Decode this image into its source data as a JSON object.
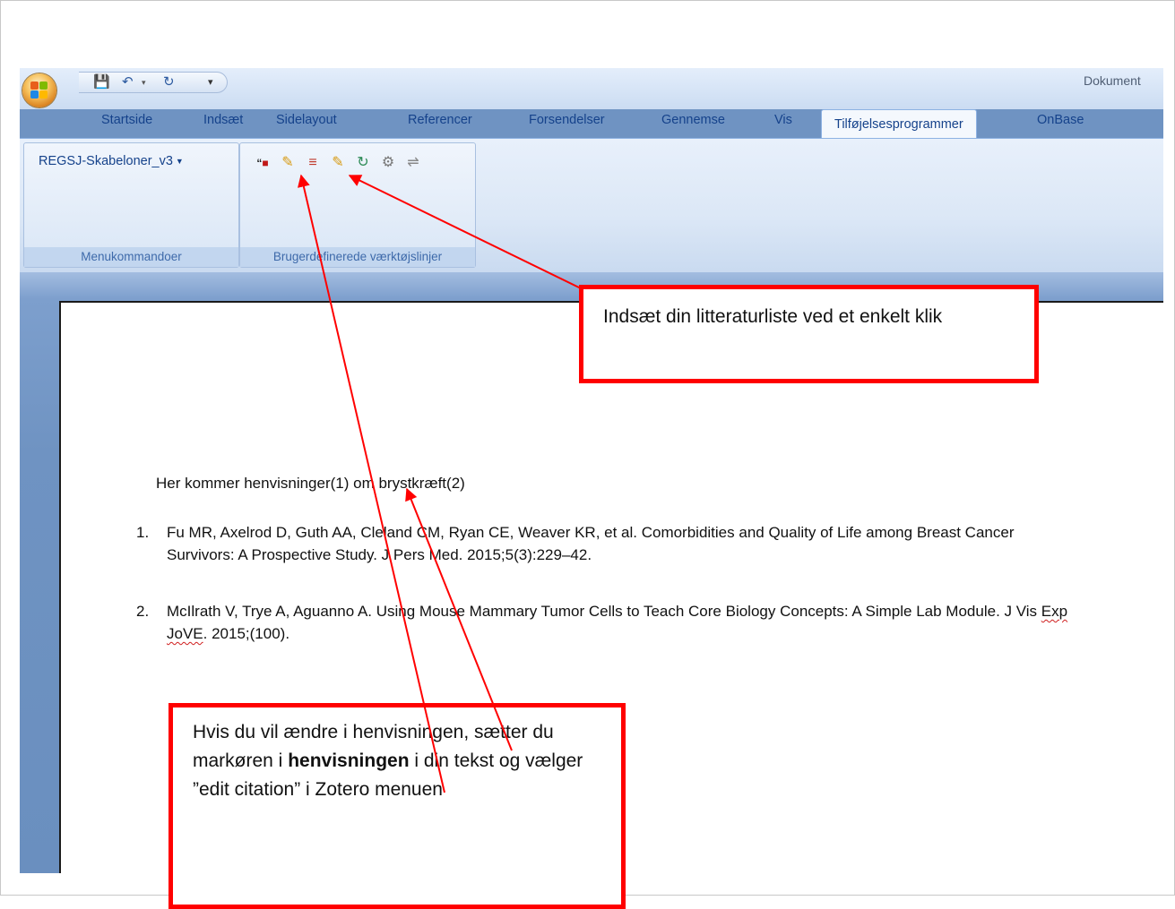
{
  "window": {
    "doc_title": "Dokument",
    "quick_access": [
      "save-icon",
      "undo-icon",
      "redo-icon",
      "customize-icon"
    ]
  },
  "tabs": [
    "Startside",
    "Indsæt",
    "Sidelayout",
    "Referencer",
    "Forsendelser",
    "Gennemse",
    "Vis",
    "Tilføjelsesprogrammer",
    "OnBase"
  ],
  "active_tab": "Tilføjelsesprogrammer",
  "ribbon": {
    "menu_dropdown": "REGSJ-Skabeloner_v3",
    "group1_label": "Menukommandoer",
    "group2_label": "Brugerdefinerede værktøjslinjer",
    "zotero_icons": [
      "add-citation-icon",
      "edit-citation-icon",
      "add-bibliography-icon",
      "edit-bibliography-icon",
      "refresh-icon",
      "document-preferences-icon",
      "unlink-citations-icon"
    ]
  },
  "document": {
    "paragraph": "Her kommer henvisninger(1) om brystkræft(2)",
    "references": [
      {
        "num": "1.",
        "text_a": "Fu MR, Axelrod D, Guth AA, Cleland CM, Ryan CE, Weaver KR, et al. Comorbidities and Quality of Life among Breast Cancer Survivors: A Prospective Study. J Pers Med. 2015;5(3):229–42."
      },
      {
        "num": "2.",
        "text_a": "McIlrath V, Trye A, Aguanno A. Using Mouse Mammary Tumor Cells to Teach Core Biology Concepts: A Simple Lab Module. J Vis ",
        "text_b": "Exp JoVE",
        "text_c": ". 2015;(100)."
      }
    ]
  },
  "callouts": {
    "top": "Indsæt din litteraturliste ved et enkelt klik",
    "bottom_a": "Hvis du vil ændre i henvisningen, sætter du markøren i ",
    "bottom_bold": "henvisningen",
    "bottom_b": " i din tekst og vælger ”edit citation” i Zotero menuen"
  },
  "colors": {
    "accent_red": "#ff0000",
    "ribbon_text": "#15428b"
  }
}
